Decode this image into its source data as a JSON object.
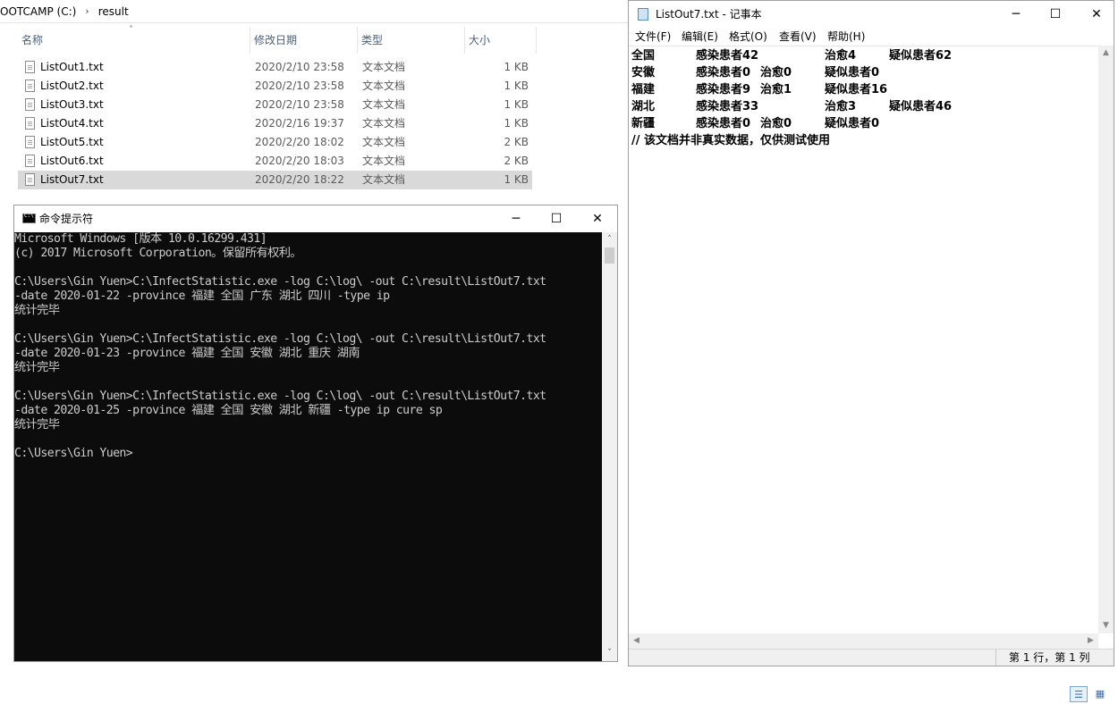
{
  "explorer": {
    "breadcrumb": {
      "drive": "OOTCAMP (C:)",
      "folder": "result"
    },
    "columns": {
      "name": "名称",
      "date": "修改日期",
      "type": "类型",
      "size": "大小"
    },
    "files": [
      {
        "name": "ListOut1.txt",
        "date": "2020/2/10 23:58",
        "type": "文本文档",
        "size": "1 KB"
      },
      {
        "name": "ListOut2.txt",
        "date": "2020/2/10 23:58",
        "type": "文本文档",
        "size": "1 KB"
      },
      {
        "name": "ListOut3.txt",
        "date": "2020/2/10 23:58",
        "type": "文本文档",
        "size": "1 KB"
      },
      {
        "name": "ListOut4.txt",
        "date": "2020/2/16 19:37",
        "type": "文本文档",
        "size": "1 KB"
      },
      {
        "name": "ListOut5.txt",
        "date": "2020/2/20 18:02",
        "type": "文本文档",
        "size": "2 KB"
      },
      {
        "name": "ListOut6.txt",
        "date": "2020/2/20 18:03",
        "type": "文本文档",
        "size": "2 KB"
      },
      {
        "name": "ListOut7.txt",
        "date": "2020/2/20 18:22",
        "type": "文本文档",
        "size": "1 KB"
      }
    ],
    "selected_index": 6
  },
  "notepad": {
    "title": "ListOut7.txt - 记事本",
    "menu": [
      "文件(F)",
      "编辑(E)",
      "格式(O)",
      "查看(V)",
      "帮助(H)"
    ],
    "lines": [
      {
        "province": "全国",
        "infected": "感染患者42",
        "cured": "治愈4",
        "suspected": "疑似患者62"
      },
      {
        "province": "安徽",
        "infected": "感染患者0",
        "cured": "治愈0",
        "suspected": "疑似患者0"
      },
      {
        "province": "福建",
        "infected": "感染患者9",
        "cured": "治愈1",
        "suspected": "疑似患者16"
      },
      {
        "province": "湖北",
        "infected": "感染患者33",
        "cured": "治愈3",
        "suspected": "疑似患者46"
      },
      {
        "province": "新疆",
        "infected": "感染患者0",
        "cured": "治愈0",
        "suspected": "疑似患者0"
      }
    ],
    "footer_line": "// 该文档并非真实数据，仅供测试使用",
    "status": "第 1 行，第 1 列"
  },
  "cmd": {
    "title": "命令提示符",
    "lines": [
      "Microsoft Windows [版本 10.0.16299.431]",
      "(c) 2017 Microsoft Corporation。保留所有权利。",
      "",
      "C:\\Users\\Gin Yuen>C:\\InfectStatistic.exe -log C:\\log\\ -out C:\\result\\ListOut7.txt",
      "-date 2020-01-22 -province 福建 全国 广东 湖北 四川 -type ip",
      "统计完毕",
      "",
      "C:\\Users\\Gin Yuen>C:\\InfectStatistic.exe -log C:\\log\\ -out C:\\result\\ListOut7.txt",
      "-date 2020-01-23 -province 福建 全国 安徽 湖北 重庆 湖南",
      "统计完毕",
      "",
      "C:\\Users\\Gin Yuen>C:\\InfectStatistic.exe -log C:\\log\\ -out C:\\result\\ListOut7.txt",
      "-date 2020-01-25 -province 福建 全国 安徽 湖北 新疆 -type ip cure sp",
      "统计完毕",
      "",
      "C:\\Users\\Gin Yuen>"
    ]
  },
  "window_buttons": {
    "minimize": "─",
    "maximize": "☐",
    "close": "✕"
  },
  "colors": {
    "cmd_background": "#0c0c0c",
    "cmd_text": "#cccccc",
    "selection": "#d9d9d9"
  }
}
